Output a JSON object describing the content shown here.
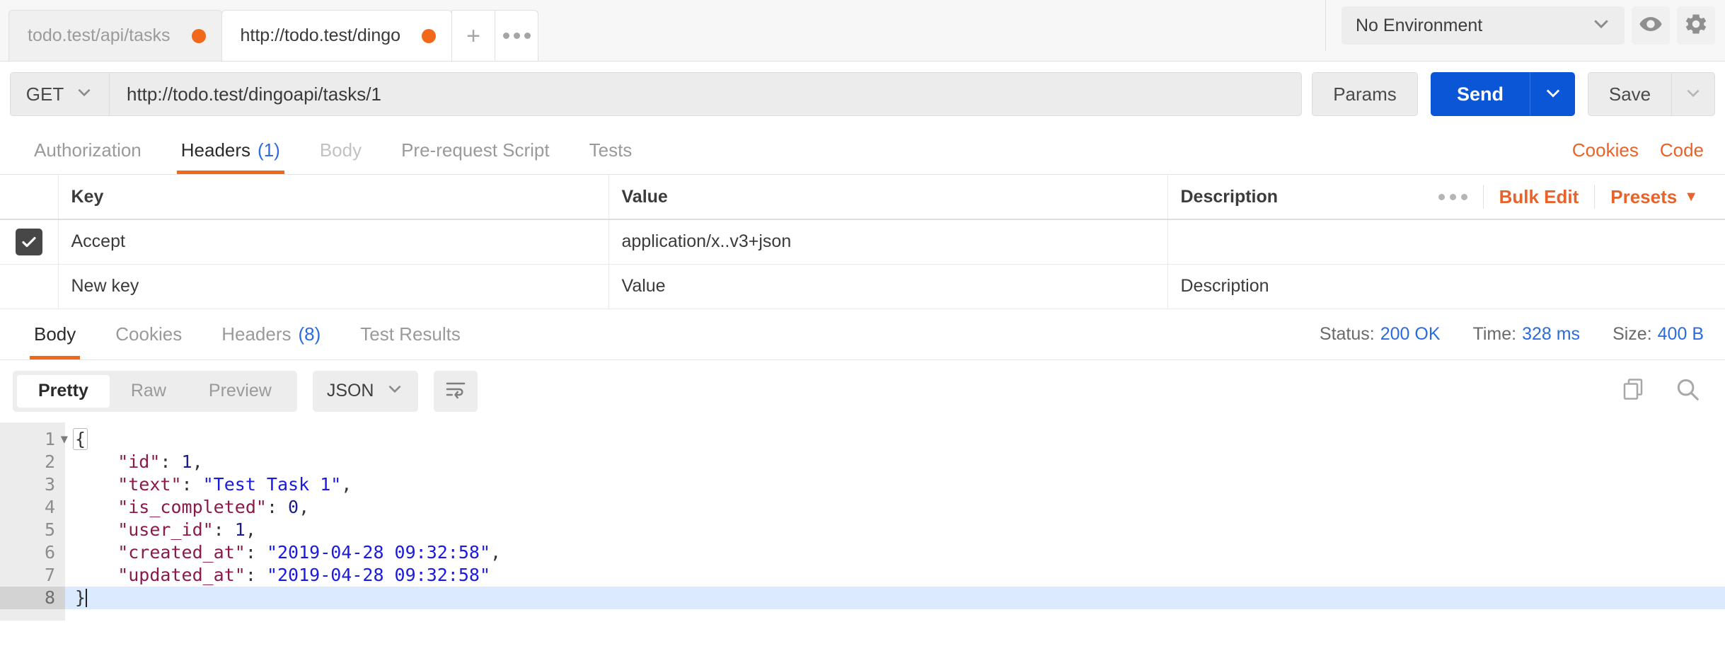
{
  "tabbar": {
    "tabs": [
      {
        "label": "todo.test/api/tasks",
        "active": false,
        "unsaved": true
      },
      {
        "label": "http://todo.test/dingo",
        "active": true,
        "unsaved": true
      }
    ],
    "new_tab_icon": "plus-icon",
    "more_tabs_icon": "ellipsis-icon",
    "environment": "No Environment",
    "eye_icon": "eye-icon",
    "settings_icon": "gear-icon"
  },
  "request": {
    "method": "GET",
    "url": "http://todo.test/dingoapi/tasks/1",
    "params_label": "Params",
    "send_label": "Send",
    "save_label": "Save"
  },
  "request_tabs": {
    "items": [
      {
        "label": "Authorization",
        "count": "",
        "state": "normal"
      },
      {
        "label": "Headers",
        "count": "(1)",
        "state": "active"
      },
      {
        "label": "Body",
        "count": "",
        "state": "disabled"
      },
      {
        "label": "Pre-request Script",
        "count": "",
        "state": "normal"
      },
      {
        "label": "Tests",
        "count": "",
        "state": "normal"
      }
    ],
    "cookies_label": "Cookies",
    "code_label": "Code"
  },
  "headers_table": {
    "columns": [
      "Key",
      "Value",
      "Description"
    ],
    "tools": {
      "more_icon": "ellipsis-icon",
      "bulk_edit": "Bulk Edit",
      "presets": "Presets"
    },
    "rows": [
      {
        "checked": true,
        "key": "Accept",
        "value": "application/x..v3+json",
        "description": ""
      }
    ],
    "placeholders": {
      "key": "New key",
      "value": "Value",
      "description": "Description"
    }
  },
  "response": {
    "tabs": [
      {
        "label": "Body",
        "count": "",
        "state": "active"
      },
      {
        "label": "Cookies",
        "count": "",
        "state": "normal"
      },
      {
        "label": "Headers",
        "count": "(8)",
        "state": "normal"
      },
      {
        "label": "Test Results",
        "count": "",
        "state": "normal"
      }
    ],
    "status_label": "Status:",
    "status_value": "200 OK",
    "time_label": "Time:",
    "time_value": "328 ms",
    "size_label": "Size:",
    "size_value": "400 B"
  },
  "body_toolbar": {
    "modes": [
      {
        "label": "Pretty",
        "active": true
      },
      {
        "label": "Raw",
        "active": false
      },
      {
        "label": "Preview",
        "active": false
      }
    ],
    "format": "JSON",
    "wrap_icon": "word-wrap-icon",
    "copy_icon": "copy-icon",
    "search_icon": "search-icon"
  },
  "code_viewer": {
    "line_numbers": [
      "1",
      "2",
      "3",
      "4",
      "5",
      "6",
      "7",
      "8"
    ],
    "highlighted_line": 8,
    "raw_text": "{\n    \"id\": 1,\n    \"text\": \"Test Task 1\",\n    \"is_completed\": 0,\n    \"user_id\": 1,\n    \"created_at\": \"2019-04-28 09:32:58\",\n    \"updated_at\": \"2019-04-28 09:32:58\"\n}",
    "json": {
      "id": 1,
      "text": "Test Task 1",
      "is_completed": 0,
      "user_id": 1,
      "created_at": "2019-04-28 09:32:58",
      "updated_at": "2019-04-28 09:32:58"
    },
    "lines": [
      {
        "n": "1",
        "tokens": [
          {
            "t": "p",
            "v": "{"
          }
        ]
      },
      {
        "n": "2",
        "tokens": [
          {
            "t": "k",
            "v": "    \"id\""
          },
          {
            "t": "p",
            "v": ": "
          },
          {
            "t": "n",
            "v": "1"
          },
          {
            "t": "p",
            "v": ","
          }
        ]
      },
      {
        "n": "3",
        "tokens": [
          {
            "t": "k",
            "v": "    \"text\""
          },
          {
            "t": "p",
            "v": ": "
          },
          {
            "t": "s",
            "v": "\"Test Task 1\""
          },
          {
            "t": "p",
            "v": ","
          }
        ]
      },
      {
        "n": "4",
        "tokens": [
          {
            "t": "k",
            "v": "    \"is_completed\""
          },
          {
            "t": "p",
            "v": ": "
          },
          {
            "t": "n",
            "v": "0"
          },
          {
            "t": "p",
            "v": ","
          }
        ]
      },
      {
        "n": "5",
        "tokens": [
          {
            "t": "k",
            "v": "    \"user_id\""
          },
          {
            "t": "p",
            "v": ": "
          },
          {
            "t": "n",
            "v": "1"
          },
          {
            "t": "p",
            "v": ","
          }
        ]
      },
      {
        "n": "6",
        "tokens": [
          {
            "t": "k",
            "v": "    \"created_at\""
          },
          {
            "t": "p",
            "v": ": "
          },
          {
            "t": "s",
            "v": "\"2019-04-28 09:32:58\""
          },
          {
            "t": "p",
            "v": ","
          }
        ]
      },
      {
        "n": "7",
        "tokens": [
          {
            "t": "k",
            "v": "    \"updated_at\""
          },
          {
            "t": "p",
            "v": ": "
          },
          {
            "t": "s",
            "v": "\"2019-04-28 09:32:58\""
          }
        ]
      },
      {
        "n": "8",
        "tokens": [
          {
            "t": "p",
            "v": "}"
          }
        ]
      }
    ]
  },
  "colors": {
    "accent_orange": "#f2681a",
    "send_blue": "#0a56d6",
    "link_blue": "#2a6ce0",
    "json_key": "#8b1a4a",
    "json_string": "#1a1ae0",
    "json_number": "#1c1c8c"
  }
}
